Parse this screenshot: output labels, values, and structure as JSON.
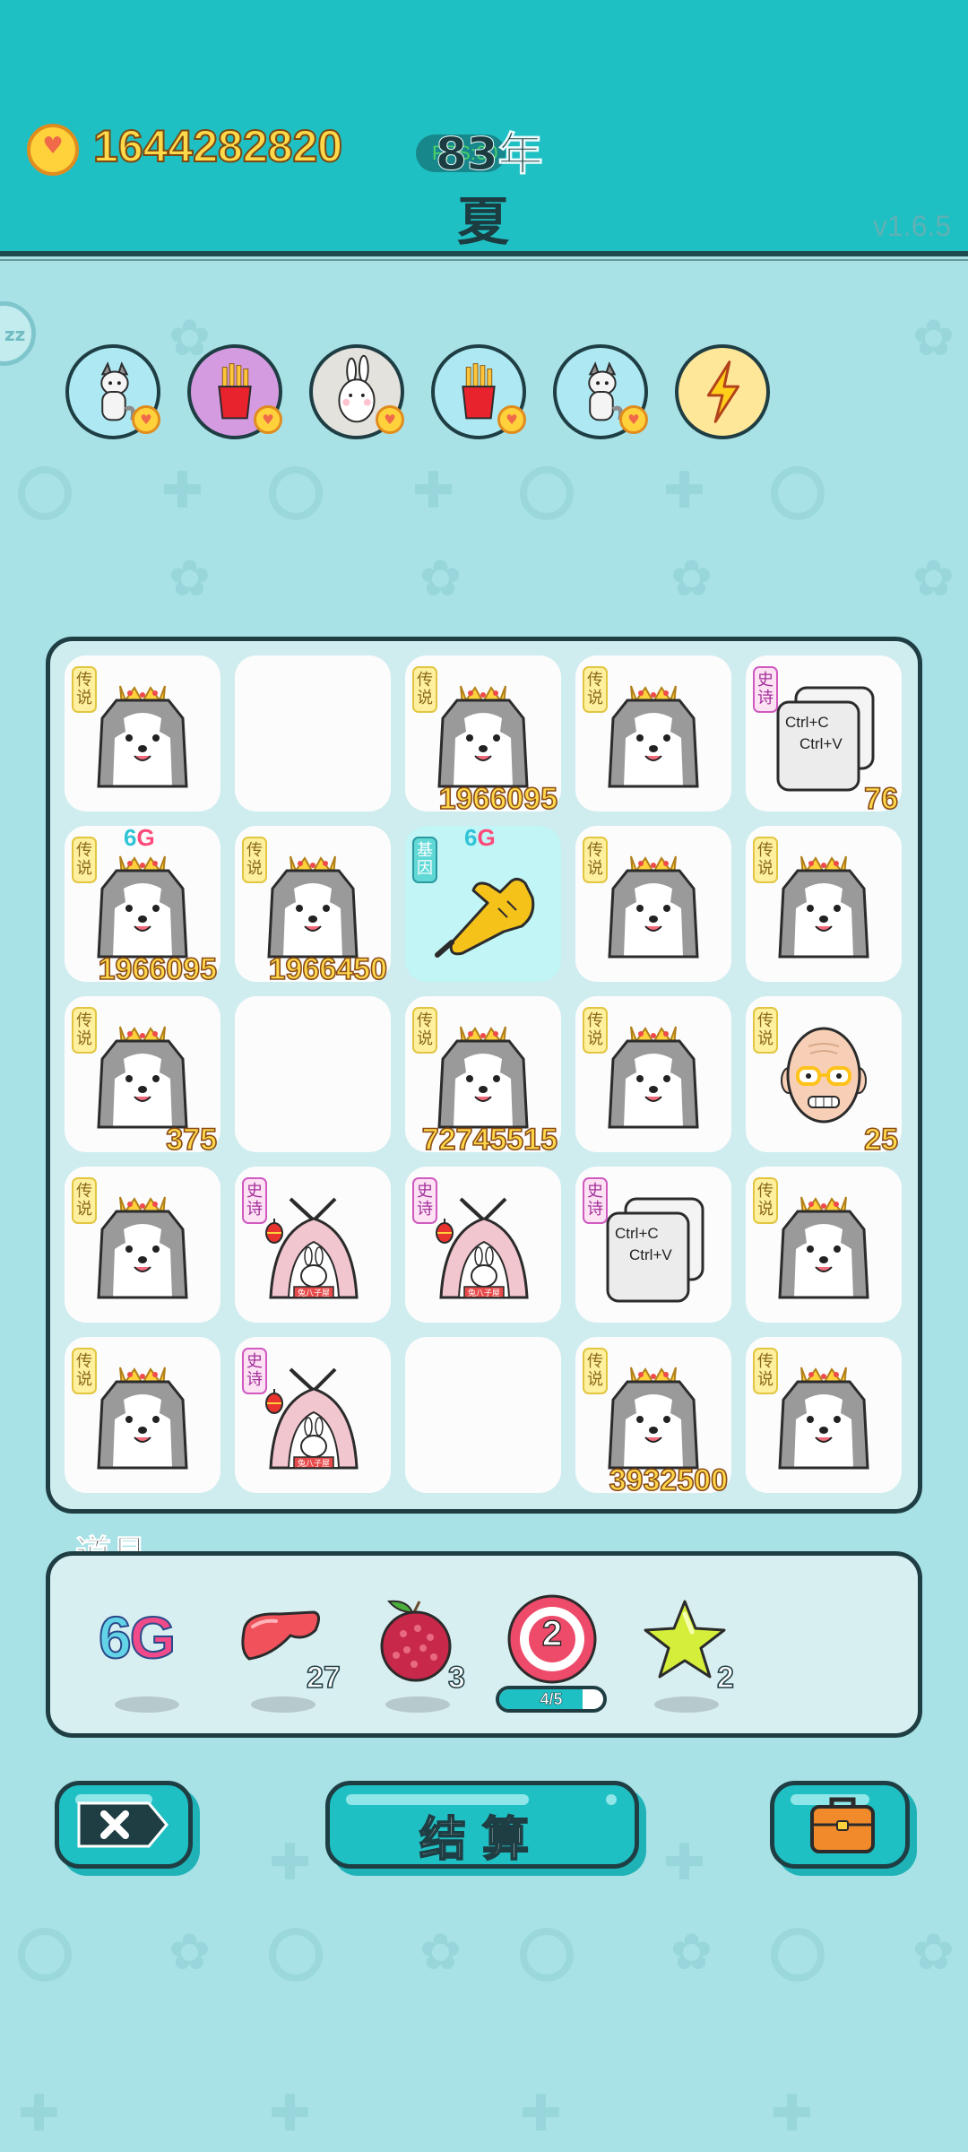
{
  "header": {
    "coins": "1644282820",
    "fps_label": "FPS:60",
    "year": "83年",
    "season": "夏",
    "version": "v1.6.5"
  },
  "sleep_button": {
    "label": "zz"
  },
  "buffs": [
    {
      "icon": "husky-icon",
      "color": "#aee9f3"
    },
    {
      "icon": "fries-icon",
      "color": "#d59be0"
    },
    {
      "icon": "rabbit-icon",
      "color": "#e4e2dc"
    },
    {
      "icon": "fries-icon",
      "color": "#aee9f3"
    },
    {
      "icon": "husky-icon",
      "color": "#aee9f3"
    },
    {
      "icon": "lightning-icon",
      "color": "#ffe79a"
    }
  ],
  "board": {
    "rows": 5,
    "cols": 5,
    "cells": [
      {
        "item": "husky-king",
        "tag": "传说",
        "tag_type": "legend",
        "value": ""
      },
      {
        "item": "empty",
        "tag": "",
        "tag_type": "",
        "value": ""
      },
      {
        "item": "husky-king",
        "tag": "传说",
        "tag_type": "legend",
        "value": "1966095"
      },
      {
        "item": "husky-king",
        "tag": "传说",
        "tag_type": "legend",
        "value": ""
      },
      {
        "item": "copy-paste",
        "tag": "史诗",
        "tag_type": "epic",
        "value": "76"
      },
      {
        "item": "husky-king",
        "tag": "传说",
        "tag_type": "legend",
        "value": "1966095",
        "sixg": "6G"
      },
      {
        "item": "husky-king",
        "tag": "传说",
        "tag_type": "legend",
        "value": "1966450"
      },
      {
        "item": "pointing-hand",
        "tag": "基因",
        "tag_type": "gene",
        "value": "",
        "sixg": "6G",
        "active": true
      },
      {
        "item": "husky-king",
        "tag": "传说",
        "tag_type": "legend",
        "value": ""
      },
      {
        "item": "husky-king",
        "tag": "传说",
        "tag_type": "legend",
        "value": ""
      },
      {
        "item": "husky-king",
        "tag": "传说",
        "tag_type": "legend",
        "value": "375"
      },
      {
        "item": "empty",
        "tag": "",
        "tag_type": "",
        "value": ""
      },
      {
        "item": "husky-king",
        "tag": "传说",
        "tag_type": "legend",
        "value": "72745515"
      },
      {
        "item": "husky-king",
        "tag": "传说",
        "tag_type": "legend",
        "value": ""
      },
      {
        "item": "old-man",
        "tag": "传说",
        "tag_type": "legend",
        "value": "25"
      },
      {
        "item": "husky-king",
        "tag": "传说",
        "tag_type": "legend",
        "value": ""
      },
      {
        "item": "rabbit-tent",
        "tag": "史诗",
        "tag_type": "epic",
        "value": ""
      },
      {
        "item": "rabbit-tent",
        "tag": "史诗",
        "tag_type": "epic",
        "value": ""
      },
      {
        "item": "copy-paste",
        "tag": "史诗",
        "tag_type": "epic",
        "value": ""
      },
      {
        "item": "husky-king",
        "tag": "传说",
        "tag_type": "legend",
        "value": ""
      },
      {
        "item": "husky-king",
        "tag": "传说",
        "tag_type": "legend",
        "value": ""
      },
      {
        "item": "rabbit-tent",
        "tag": "史诗",
        "tag_type": "epic",
        "value": ""
      },
      {
        "item": "empty",
        "tag": "",
        "tag_type": "",
        "value": ""
      },
      {
        "item": "husky-king",
        "tag": "传说",
        "tag_type": "legend",
        "value": "3932500"
      },
      {
        "item": "husky-king",
        "tag": "传说",
        "tag_type": "legend",
        "value": ""
      }
    ],
    "copy_text_1": "Ctrl+C",
    "copy_text_2": "Ctrl+V",
    "tent_sign": "兔八子屋"
  },
  "props": {
    "title": "道具",
    "items": [
      {
        "icon": "6g-icon",
        "label_a": "6",
        "label_b": "G",
        "count": ""
      },
      {
        "icon": "liver-icon",
        "count": "27"
      },
      {
        "icon": "lychee-icon",
        "count": "3"
      },
      {
        "icon": "target-icon",
        "badge": "2",
        "progress_text": "4/5",
        "progress": 0.8,
        "count": ""
      },
      {
        "icon": "star-icon",
        "count": "2"
      }
    ]
  },
  "buttons": {
    "delete_icon": "delete-icon",
    "settle_label": "结算",
    "bag_icon": "briefcase-icon"
  }
}
